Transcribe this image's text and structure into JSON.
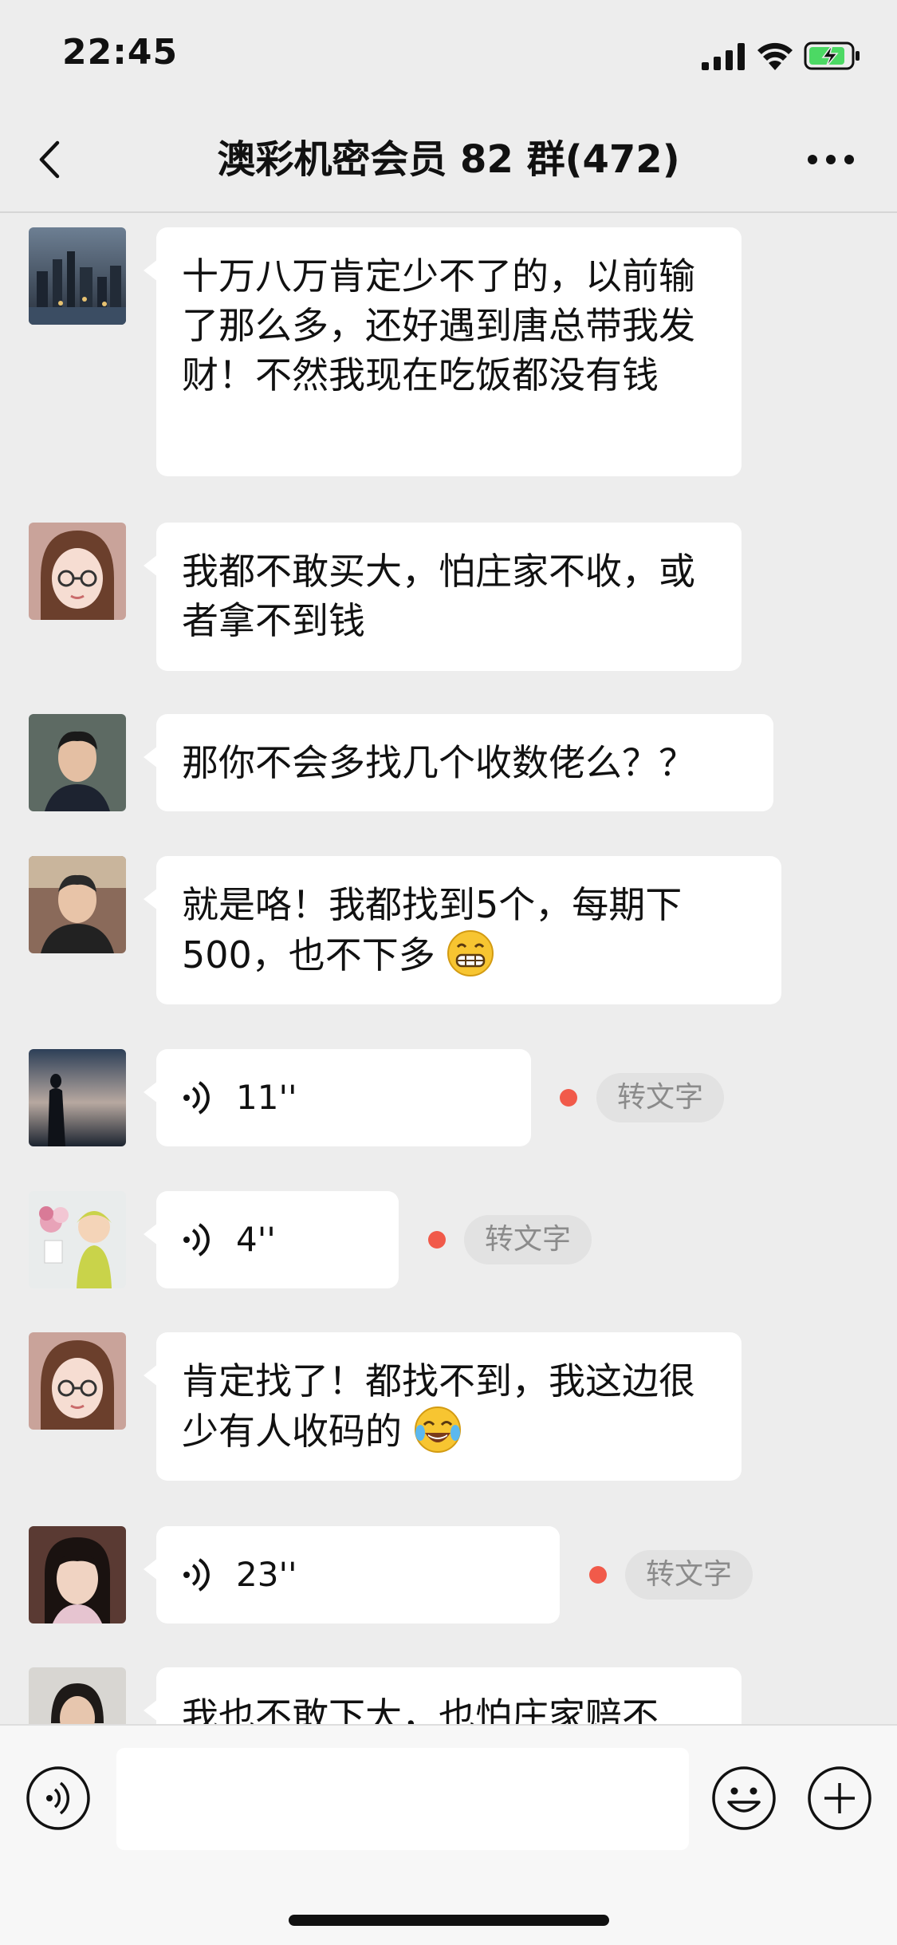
{
  "status_bar": {
    "time": "22:45"
  },
  "nav": {
    "title": "澳彩机密会员 82 群(472)"
  },
  "messages": [
    {
      "type": "text",
      "avatar": "city-skyline-avatar",
      "text": "十万八万肯定少不了的，以前输了那么多，还好遇到唐总带我发财！不然我现在吃饭都没有钱"
    },
    {
      "type": "text",
      "avatar": "glasses-girl-avatar",
      "text": "我都不敢买大，怕庄家不收，或者拿不到钱"
    },
    {
      "type": "text",
      "avatar": "young-man-avatar",
      "text": "那你不会多找几个收数佬么？？"
    },
    {
      "type": "text",
      "avatar": "man-selfie-avatar",
      "text": "就是咯！我都找到5个，每期下500，也不下多",
      "emoji": "grin-emoji"
    },
    {
      "type": "voice",
      "avatar": "sunset-silhouette-avatar",
      "duration": "11''",
      "convert_label": "转文字"
    },
    {
      "type": "voice",
      "avatar": "baby-flowers-avatar",
      "duration": "4''",
      "convert_label": "转文字"
    },
    {
      "type": "text",
      "avatar": "glasses-girl-avatar",
      "text": "肯定找了！都找不到，我这边很少有人收码的",
      "emoji": "tears-of-joy-emoji"
    },
    {
      "type": "voice",
      "avatar": "girl-portrait-avatar",
      "duration": "23''",
      "convert_label": "转文字"
    },
    {
      "type": "text",
      "avatar": "woman-portrait-avatar",
      "text": "我也不敢下大，也怕庄家赔不"
    }
  ],
  "icons": {
    "back": "chevron-left-icon",
    "more": "more-dots-icon",
    "voice_mode": "voice-mode-icon",
    "emoji": "smiley-icon",
    "plus": "plus-icon"
  },
  "colors": {
    "background": "#ededed",
    "bubble": "#ffffff",
    "unread_dot": "#f15a4a",
    "battery_charge": "#4cd964"
  }
}
